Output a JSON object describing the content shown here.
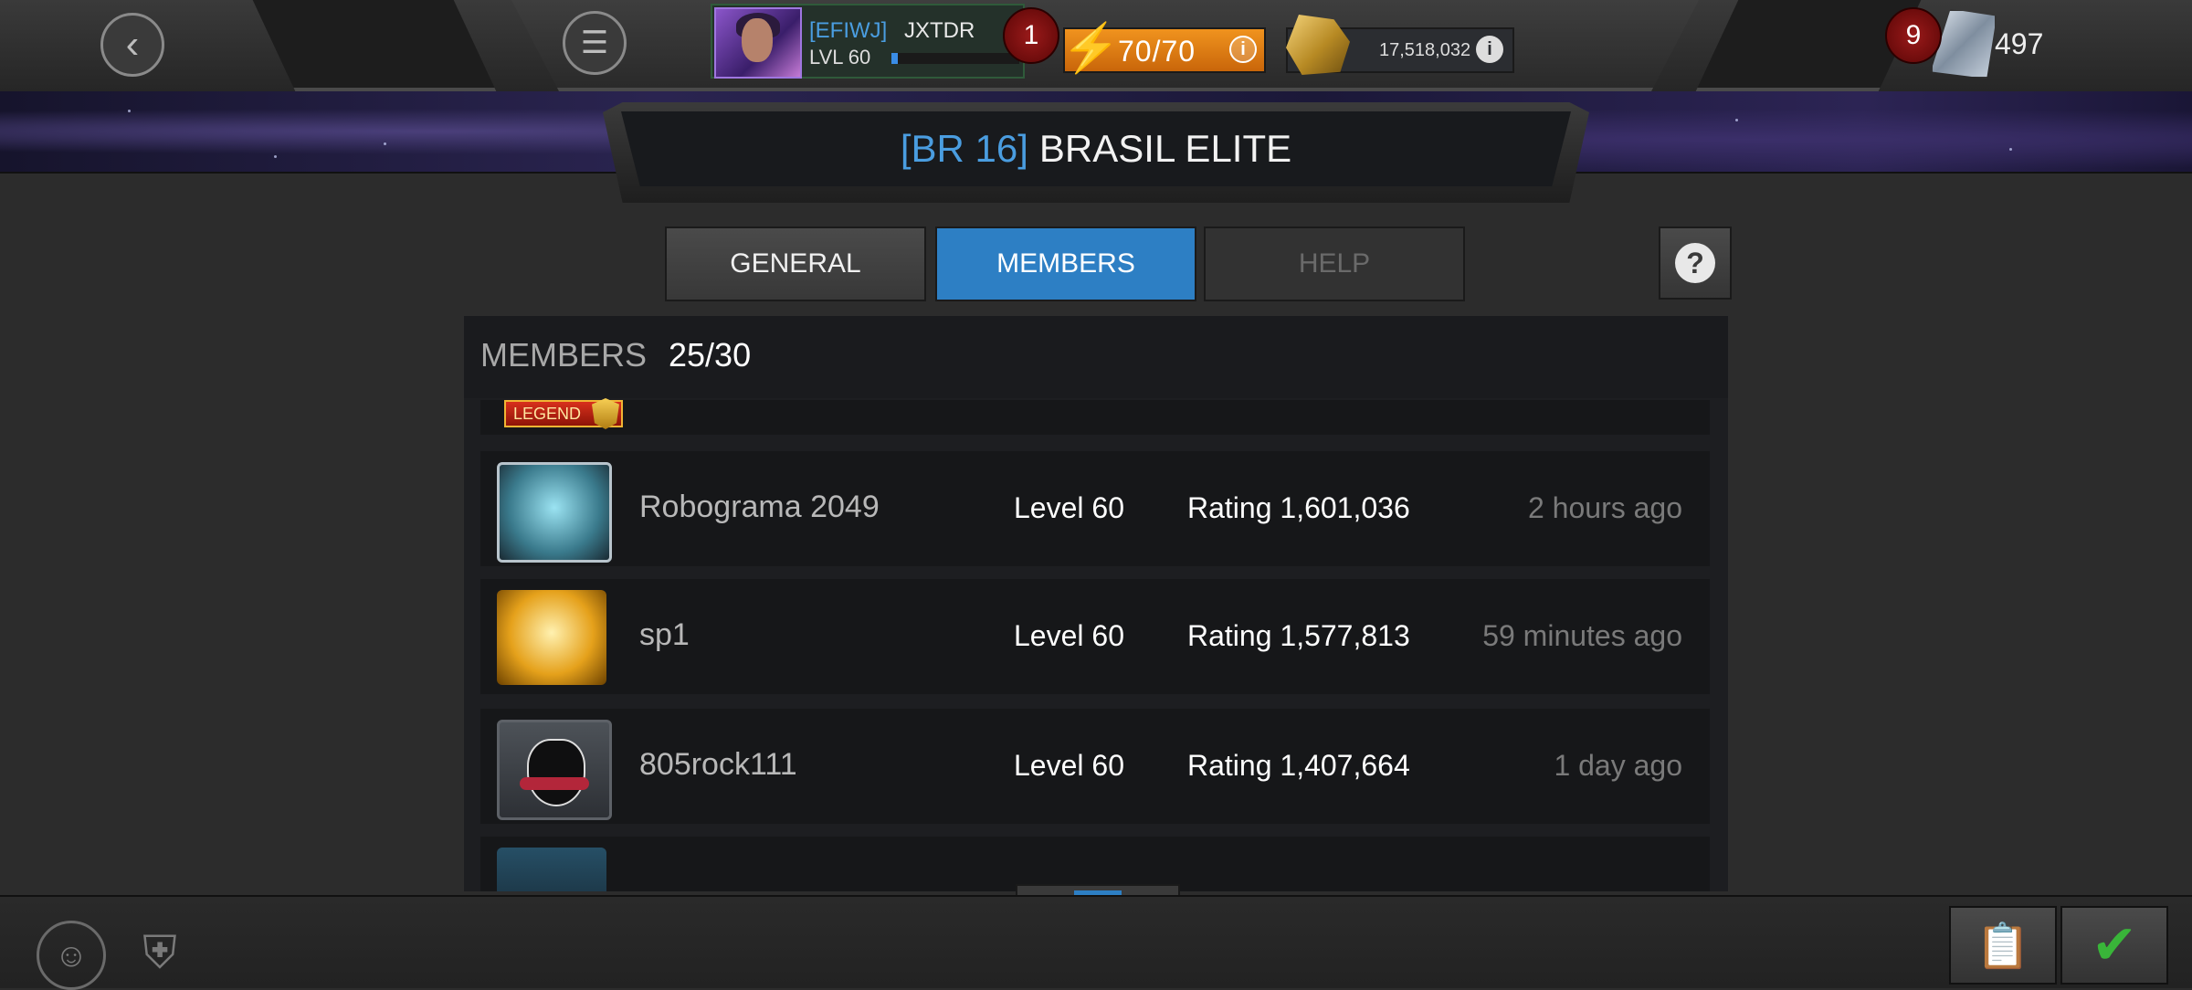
{
  "header": {
    "player_tag": "[EFIWJ]",
    "player_name": "JXTDR",
    "player_level": "LVL 60",
    "notification_count": "1",
    "energy": "70/70",
    "gold": "17,518,032",
    "units_badge": "9",
    "units": "497"
  },
  "alliance": {
    "tag": "[BR 16]",
    "name": "BRASIL ELITE"
  },
  "tabs": {
    "general": "GENERAL",
    "members": "MEMBERS",
    "help": "HELP",
    "help_icon": "?"
  },
  "members": {
    "label": "MEMBERS",
    "count": "25/30",
    "partial_top_badge": "LEGEND",
    "rows": [
      {
        "name": "Robograma 2049",
        "level": "Level 60",
        "rating": "Rating 1,601,036",
        "last_seen": "2 hours ago"
      },
      {
        "name": "sp1",
        "level": "Level 60",
        "rating": "Rating 1,577,813",
        "last_seen": "59 minutes ago"
      },
      {
        "name": "805rock111",
        "level": "Level 60",
        "rating": "Rating 1,407,664",
        "last_seen": "1 day ago"
      }
    ]
  },
  "colors": {
    "accent_blue": "#2d7fc4",
    "tag_blue": "#4a9de0",
    "energy_orange": "#f0931e"
  },
  "icons": [
    "back-arrow-icon",
    "menu-icon",
    "info-icon",
    "lightning-bolt-icon",
    "gold-icon",
    "crystal-icon",
    "help-question-icon",
    "alliance-people-icon",
    "shield-icon",
    "clipboard-icon",
    "checkmark-icon"
  ]
}
